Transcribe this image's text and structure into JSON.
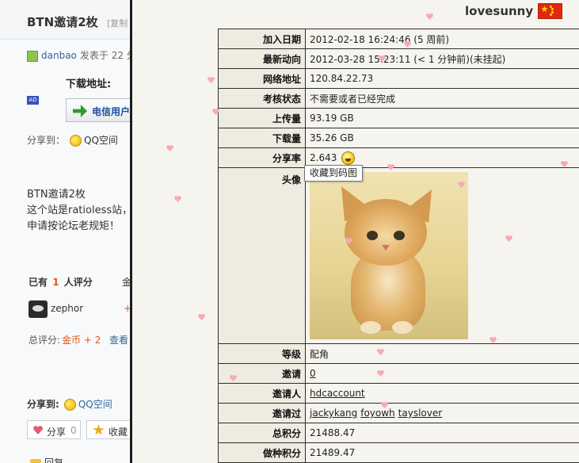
{
  "left_page": {
    "title": "BTN邀请2枚",
    "title_extra": "[复制",
    "author": "danbao",
    "author_meta": "发表于 22 分",
    "download_label": "下载地址:",
    "ad_badge": "AD",
    "telecom_button": "电信用户",
    "share_label": "分享到：",
    "share_qzone": "QQ空间",
    "body_lines": [
      "BTN邀请2枚",
      "这个站是ratioless站，",
      "申请按论坛老规矩！"
    ],
    "rate_prefix": "已有",
    "rate_count": "1",
    "rate_suffix": "人评分",
    "rate_extra": "金",
    "rater_name": "zephor",
    "rater_plus": "+",
    "total_label": "总评分:",
    "total_value": "金币 + 2",
    "total_view": "查看",
    "share2_label": "分享到:",
    "share2_qzone": "QQ空间",
    "share_button": "分享",
    "share_count": "0",
    "fav_button": "收藏",
    "reply_label": "回复"
  },
  "popup": {
    "username": "lovesunny",
    "tooltip": "收藏到码图",
    "rows": {
      "join_date": {
        "label": "加入日期",
        "value": "2012-02-18 16:24:46 (5 周前)"
      },
      "last_seen": {
        "label": "最新动向",
        "value": "2012-03-28 15:23:11 (< 1 分钟前)(未挂起)"
      },
      "ip": {
        "label": "网络地址",
        "value": "120.84.22.73"
      },
      "exam": {
        "label": "考核状态",
        "value": "不需要或者已经完成"
      },
      "uploaded": {
        "label": "上传量",
        "value": "93.19 GB"
      },
      "downloaded": {
        "label": "下载量",
        "value": "35.26 GB"
      },
      "ratio": {
        "label": "分享率",
        "value": "2.643"
      },
      "avatar": {
        "label": "头像"
      },
      "class": {
        "label": "等级",
        "value": "配角"
      },
      "invites": {
        "label": "邀请",
        "value": "0"
      },
      "invited_by": {
        "label": "邀请人",
        "value": "hdcaccount"
      },
      "invitees": {
        "label": "邀请过",
        "values": [
          "jackykang",
          "foyowh",
          "tayslover"
        ]
      },
      "total_points": {
        "label": "总积分",
        "value": "21488.47"
      },
      "seed_points": {
        "label": "做种积分",
        "value": "21489.47"
      }
    }
  }
}
